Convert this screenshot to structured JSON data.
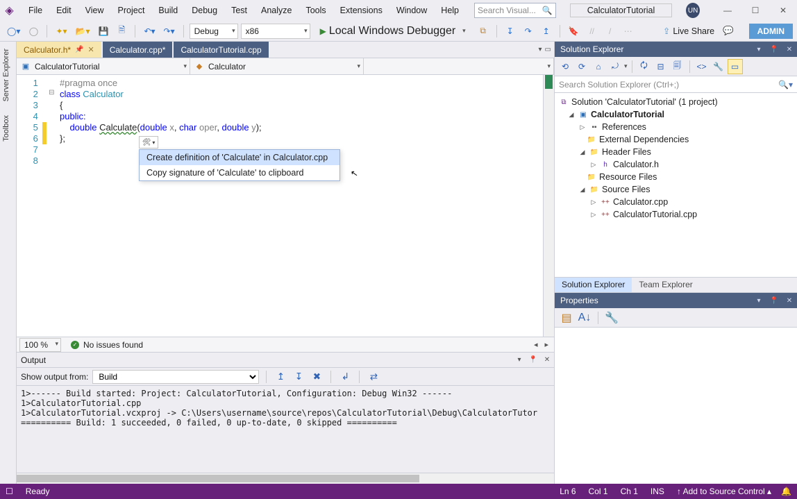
{
  "menu": {
    "file": "File",
    "edit": "Edit",
    "view": "View",
    "project": "Project",
    "build": "Build",
    "debug": "Debug",
    "test": "Test",
    "analyze": "Analyze",
    "tools": "Tools",
    "extensions": "Extensions",
    "window": "Window",
    "help": "Help"
  },
  "title_search": {
    "placeholder": "Search Visual..."
  },
  "solution_name": "CalculatorTutorial",
  "avatar_initials": "UN",
  "live_share": "Live Share",
  "admin": "ADMIN",
  "toolbar": {
    "config": "Debug",
    "platform": "x86",
    "debugger": "Local Windows Debugger"
  },
  "tabs": [
    {
      "label": "Calculator.h*",
      "active": true,
      "pinned": true
    },
    {
      "label": "Calculator.cpp*",
      "active": false
    },
    {
      "label": "CalculatorTutorial.cpp",
      "active": false
    }
  ],
  "nav": {
    "project": "CalculatorTutorial",
    "scope": "Calculator"
  },
  "code_lines": {
    "l1": "#pragma once",
    "l2a": "class",
    "l2b": "Calculator",
    "l3": "{",
    "l4": "public:",
    "l5a": "double",
    "l5b": "Calculate",
    "l5c": "double",
    "l5d": "x",
    "l5e": "char",
    "l5f": "oper",
    "l5g": "double",
    "l5h": "y",
    "l6": "};"
  },
  "quick_actions": {
    "item1": "Create definition of 'Calculate' in Calculator.cpp",
    "item2": "Copy signature of 'Calculate' to clipboard"
  },
  "zoom": "100 %",
  "issues_label": "No issues found",
  "output": {
    "title": "Output",
    "from_label": "Show output from:",
    "from_value": "Build",
    "text": "1>------ Build started: Project: CalculatorTutorial, Configuration: Debug Win32 ------\n1>CalculatorTutorial.cpp\n1>CalculatorTutorial.vcxproj -> C:\\Users\\username\\source\\repos\\CalculatorTutorial\\Debug\\CalculatorTutor\n========== Build: 1 succeeded, 0 failed, 0 up-to-date, 0 skipped =========="
  },
  "solution_explorer": {
    "title": "Solution Explorer",
    "search_placeholder": "Search Solution Explorer (Ctrl+;)",
    "sln": "Solution 'CalculatorTutorial' (1 project)",
    "proj": "CalculatorTutorial",
    "refs": "References",
    "ext": "External Dependencies",
    "hdr": "Header Files",
    "calc_h": "Calculator.h",
    "res": "Resource Files",
    "src": "Source Files",
    "calc_cpp": "Calculator.cpp",
    "main_cpp": "CalculatorTutorial.cpp",
    "tab_se": "Solution Explorer",
    "tab_te": "Team Explorer"
  },
  "properties": {
    "title": "Properties"
  },
  "status": {
    "ready": "Ready",
    "ln": "Ln 6",
    "col": "Col 1",
    "ch": "Ch 1",
    "ins": "INS",
    "src_ctrl": "↑ Add to Source Control ▴"
  },
  "side_tabs": {
    "server": "Server Explorer",
    "toolbox": "Toolbox"
  }
}
